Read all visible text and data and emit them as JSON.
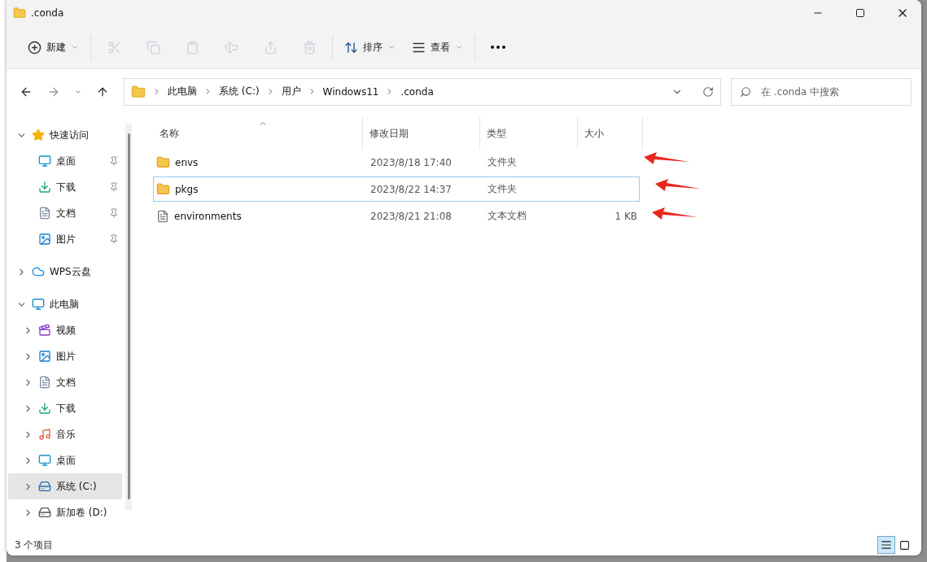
{
  "window": {
    "title": ".conda"
  },
  "toolbar": [
    {
      "kind": "new",
      "label": "新建",
      "disabled": false
    },
    {
      "kind": "cut",
      "disabled": true
    },
    {
      "kind": "copy",
      "disabled": true
    },
    {
      "kind": "paste",
      "disabled": true
    },
    {
      "kind": "rename",
      "disabled": true
    },
    {
      "kind": "share",
      "disabled": true
    },
    {
      "kind": "delete",
      "disabled": true
    },
    {
      "kind": "sort",
      "label": "排序",
      "disabled": false
    },
    {
      "kind": "view",
      "label": "查看",
      "disabled": false
    },
    {
      "kind": "more",
      "disabled": false
    }
  ],
  "navigation": {
    "back_disabled": false,
    "forward_disabled": true
  },
  "breadcrumbs": [
    "此电脑",
    "系统 (C:)",
    "用户",
    "Windows11",
    ".conda"
  ],
  "search": {
    "placeholder": "在 .conda 中搜索"
  },
  "sidebar": {
    "items": [
      {
        "kind": "star",
        "label": "快速访问",
        "expanded": true,
        "selected": false,
        "children": [
          {
            "kind": "desktop",
            "label": "桌面",
            "pinned": true,
            "selected": false
          },
          {
            "kind": "download",
            "label": "下载",
            "pinned": true,
            "selected": false
          },
          {
            "kind": "document",
            "label": "文档",
            "pinned": true,
            "selected": false
          },
          {
            "kind": "picture",
            "label": "图片",
            "pinned": true,
            "selected": false
          }
        ]
      },
      {
        "kind": "cloud",
        "label": "WPS云盘",
        "expanded": false,
        "selected": false
      },
      {
        "kind": "pc",
        "label": "此电脑",
        "expanded": true,
        "selected": false,
        "children": [
          {
            "kind": "video",
            "label": "视频",
            "expanded": false,
            "selected": false
          },
          {
            "kind": "picture",
            "label": "图片",
            "expanded": false,
            "selected": false
          },
          {
            "kind": "document",
            "label": "文档",
            "expanded": false,
            "selected": false
          },
          {
            "kind": "download",
            "label": "下载",
            "expanded": false,
            "selected": false
          },
          {
            "kind": "music",
            "label": "音乐",
            "expanded": false,
            "selected": false
          },
          {
            "kind": "desktop",
            "label": "桌面",
            "expanded": false,
            "selected": false
          },
          {
            "kind": "system-drive",
            "label": "系统 (C:)",
            "expanded": false,
            "selected": true
          },
          {
            "kind": "drive",
            "label": "新加卷 (D:)",
            "expanded": false,
            "selected": false
          }
        ]
      }
    ]
  },
  "table": {
    "columns": [
      {
        "label": "名称",
        "sorted": true
      },
      {
        "label": "修改日期",
        "sorted": false
      },
      {
        "label": "类型",
        "sorted": false
      },
      {
        "label": "大小",
        "sorted": false
      }
    ],
    "rows": [
      {
        "kind": "folder",
        "name": "envs",
        "date": "2023/8/18 17:40",
        "type": "文件夹",
        "size": "",
        "focused": false,
        "arrow": true
      },
      {
        "kind": "folder",
        "name": "pkgs",
        "date": "2023/8/22 14:37",
        "type": "文件夹",
        "size": "",
        "focused": true,
        "arrow": true
      },
      {
        "kind": "file",
        "name": "environments",
        "date": "2023/8/21 21:08",
        "type": "文本文档",
        "size": "1 KB",
        "focused": false,
        "arrow": true
      }
    ]
  },
  "status_bar": {
    "text": "3 个项目",
    "views": [
      {
        "kind": "details",
        "selected": true
      },
      {
        "kind": "tiles",
        "selected": false
      }
    ]
  }
}
